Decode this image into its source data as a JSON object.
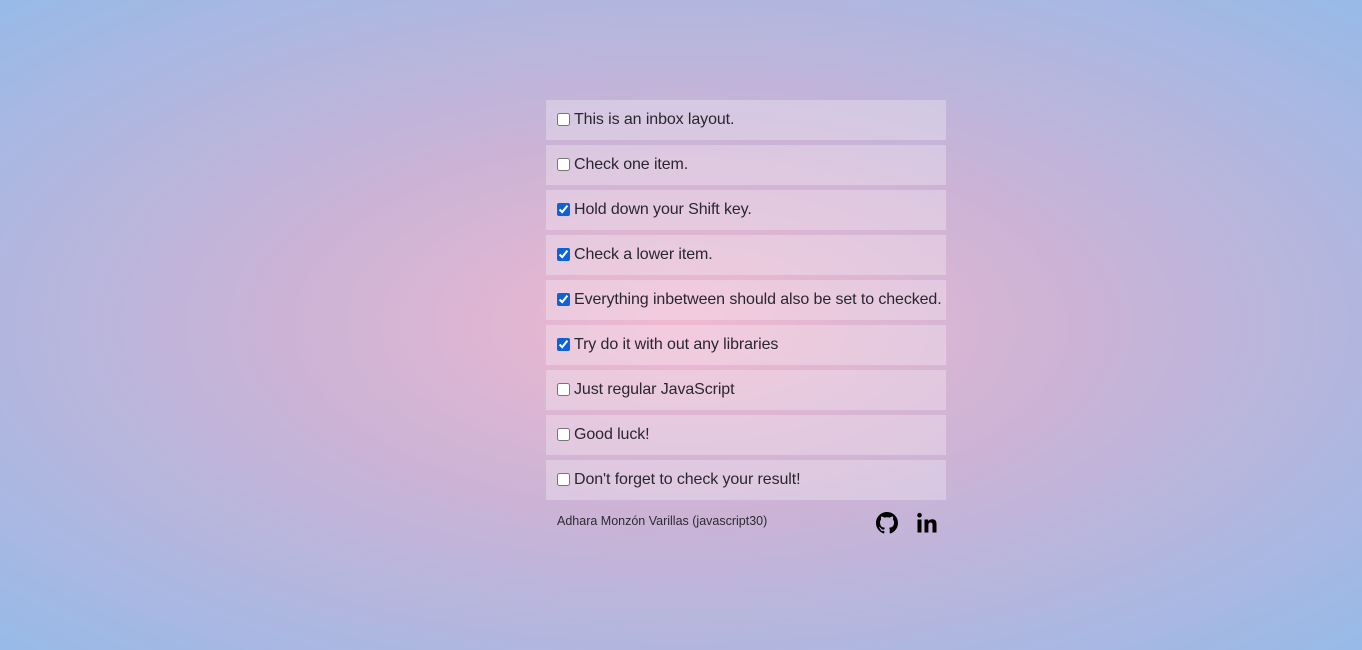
{
  "items": [
    {
      "text": "This is an inbox layout.",
      "checked": false
    },
    {
      "text": "Check one item.",
      "checked": false
    },
    {
      "text": "Hold down your Shift key.",
      "checked": true
    },
    {
      "text": "Check a lower item.",
      "checked": true
    },
    {
      "text": "Everything inbetween should also be set to checked.",
      "checked": true
    },
    {
      "text": "Try do it with out any libraries",
      "checked": true
    },
    {
      "text": "Just regular JavaScript",
      "checked": false
    },
    {
      "text": "Good luck!",
      "checked": false
    },
    {
      "text": "Don't forget to check your result!",
      "checked": false
    }
  ],
  "footer": {
    "credit": "Adhara Monzón Varillas (javascript30)",
    "icons": [
      "github-icon",
      "linkedin-icon"
    ]
  },
  "colors": {
    "checkbox_accent": "#0b63d6",
    "background_center": "#f0b8d0",
    "background_edge": "#97bae8"
  }
}
